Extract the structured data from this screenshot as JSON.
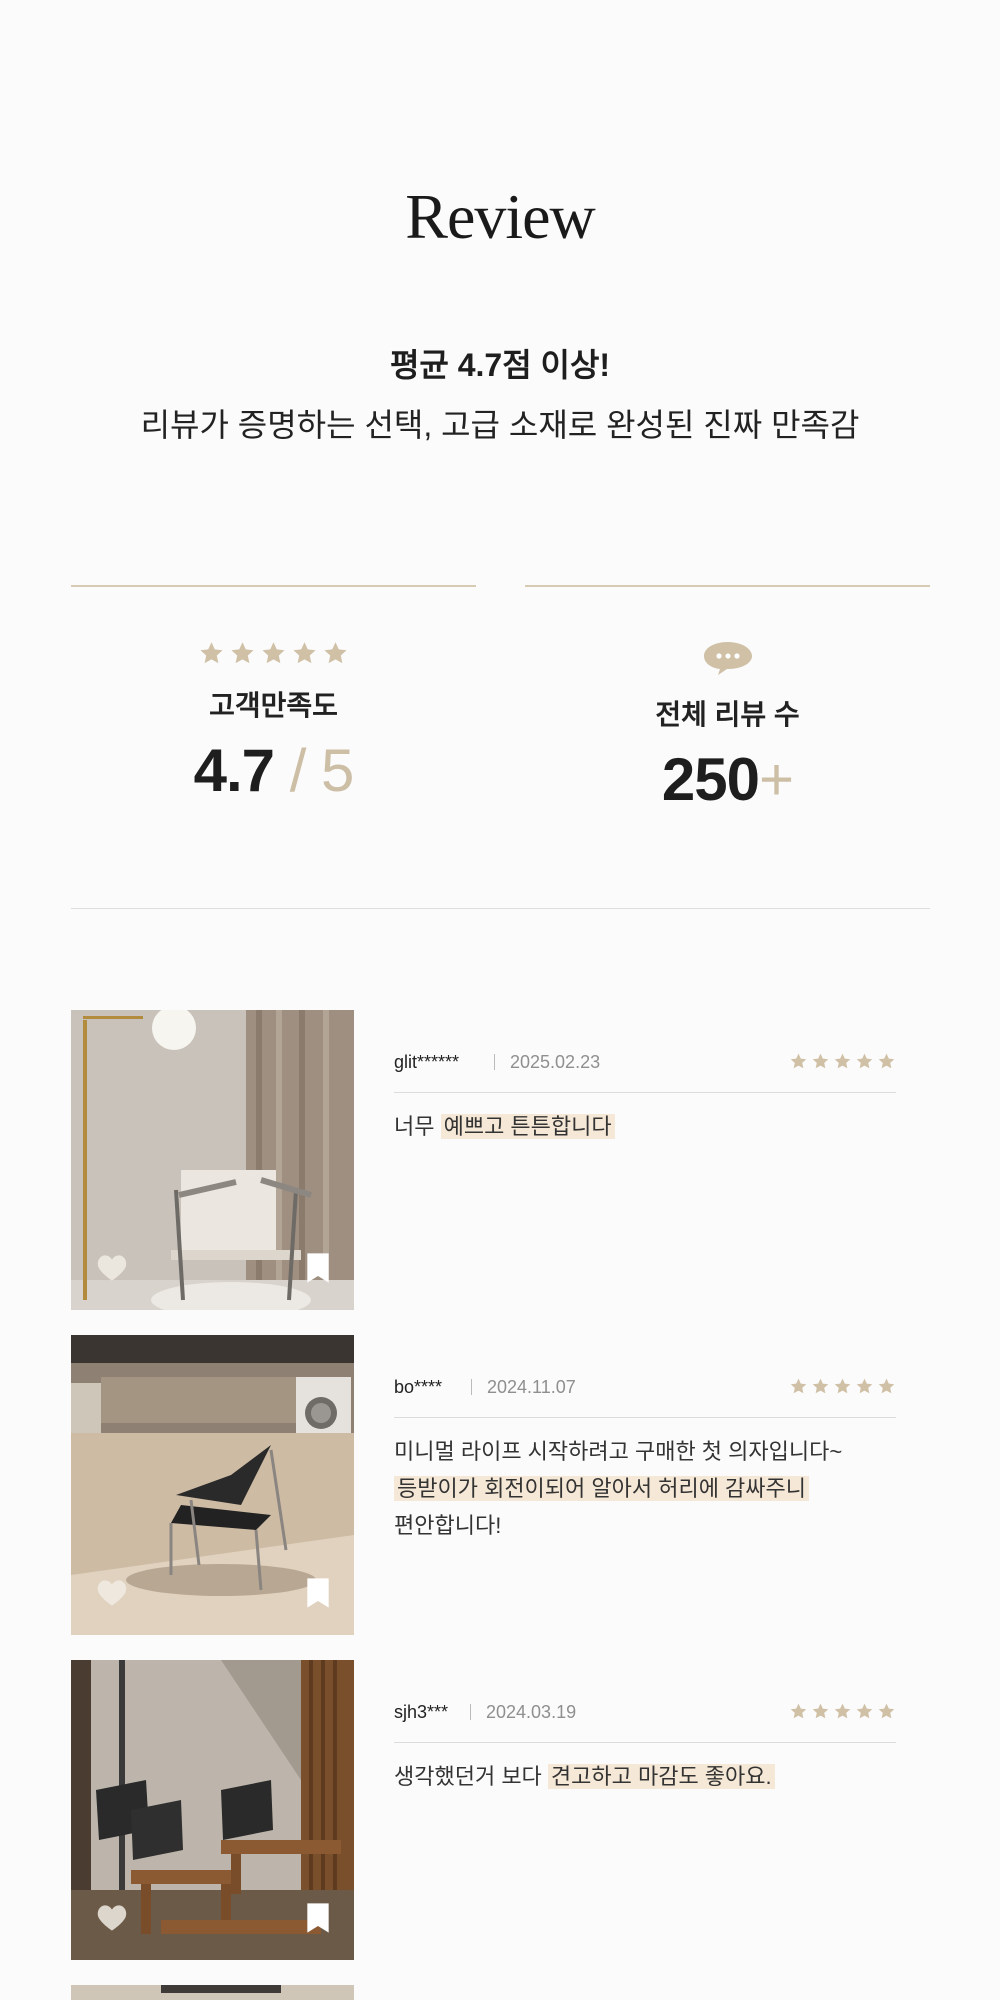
{
  "header": {
    "title": "Review",
    "headline": "평균 4.7점 이상!",
    "subline": "리뷰가 증명하는 선택, 고급 소재로 완성된 진짜 만족감"
  },
  "stats": {
    "satisfaction": {
      "icon": "star-rating-icon",
      "label": "고객만족도",
      "score": "4.7",
      "max": "/ 5",
      "stars": 5
    },
    "reviews": {
      "icon": "chat-bubble-icon",
      "label": "전체 리뷰 수",
      "count": "250",
      "suffix": "+"
    }
  },
  "reviews": [
    {
      "user": "glit******",
      "date": "2025.02.23",
      "rating": 5,
      "lines": [
        {
          "plain": "너무 ",
          "highlight": "예쁘고 튼튼합니다"
        }
      ]
    },
    {
      "user": "bo****",
      "date": "2024.11.07",
      "rating": 5,
      "lines": [
        {
          "plain": "미니멀 라이프 시작하려고 구매한 첫 의자입니다~",
          "highlight": ""
        },
        {
          "plain": "",
          "highlight": "등받이가 회전이되어 알아서 허리에 감싸주니"
        },
        {
          "plain": "편안합니다!",
          "highlight": ""
        }
      ]
    },
    {
      "user": "sjh3***",
      "date": "2024.03.19",
      "rating": 5,
      "lines": [
        {
          "plain": "생각했던거 보다 ",
          "highlight": "견고하고 마감도 좋아요."
        }
      ]
    }
  ],
  "colors": {
    "accent": "#cfc0a6",
    "highlight": "#f6e8d6",
    "divider": "#d8cbb4"
  }
}
